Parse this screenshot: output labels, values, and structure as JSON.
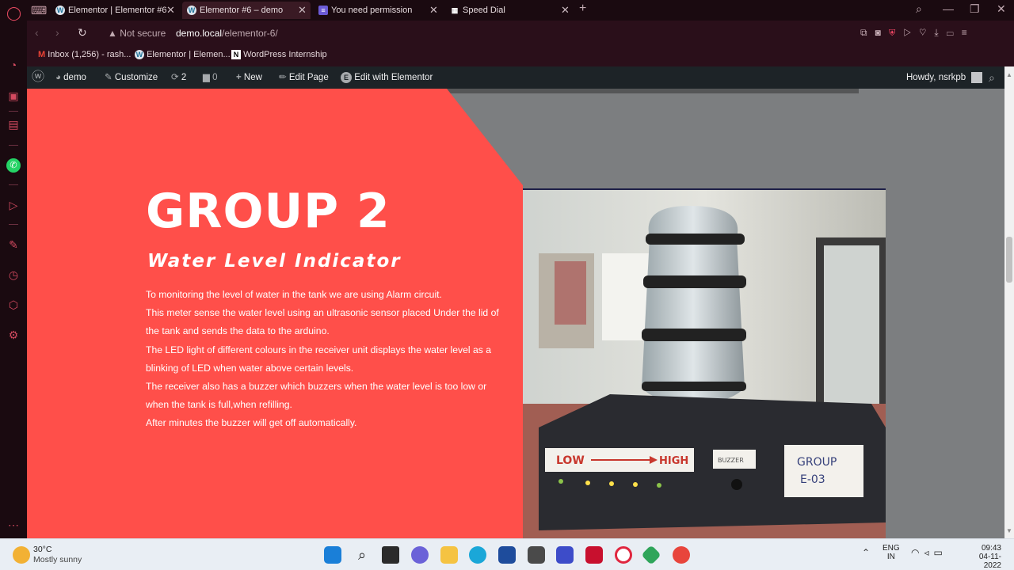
{
  "browser": {
    "tabs": [
      {
        "label": "Elementor | Elementor #6",
        "active": false
      },
      {
        "label": "Elementor #6 – demo",
        "active": true
      },
      {
        "label": "You need permission",
        "active": false
      },
      {
        "label": "Speed Dial",
        "active": false
      }
    ],
    "address": {
      "security": "Not secure",
      "url_host": "demo.local",
      "url_path": "/elementor-6/"
    },
    "bookmarks": [
      "Inbox (1,256) - rash...",
      "Elementor | Elemen...",
      "WordPress Internship"
    ]
  },
  "wp_admin_bar": {
    "site": "demo",
    "customize": "Customize",
    "updates": "2",
    "comments": "0",
    "new": "New",
    "edit_page": "Edit Page",
    "edit_elementor": "Edit with Elementor",
    "howdy": "Howdy, nsrkpb"
  },
  "hero": {
    "heading": "GROUP 2",
    "subheading": "Water Level Indicator",
    "paragraphs": [
      "To monitoring the level of water in the tank we are using Alarm circuit.",
      "This meter sense the water level using an ultrasonic sensor placed Under the lid of the tank and sends the data to the arduino.",
      "The LED light of different colours in the receiver unit displays the water level as a blinking of LED when water above certain levels.",
      "The receiver also has a buzzer which buzzers when the water level is too low or when the tank is full,when refilling.",
      "After minutes the buzzer will get off automatically."
    ],
    "photo_labels": {
      "low": "LOW",
      "high": "HIGH",
      "buzzer": "BUZZER",
      "group_line1": "GROUP",
      "group_line2": "E-03"
    },
    "colors": {
      "accent": "#ff4f4a",
      "backdrop": "#7c7e80"
    }
  },
  "taskbar": {
    "weather_temp": "30°C",
    "weather_desc": "Mostly sunny",
    "lang_line1": "ENG",
    "lang_line2": "IN",
    "time": "09:43",
    "date": "04-11-2022"
  }
}
